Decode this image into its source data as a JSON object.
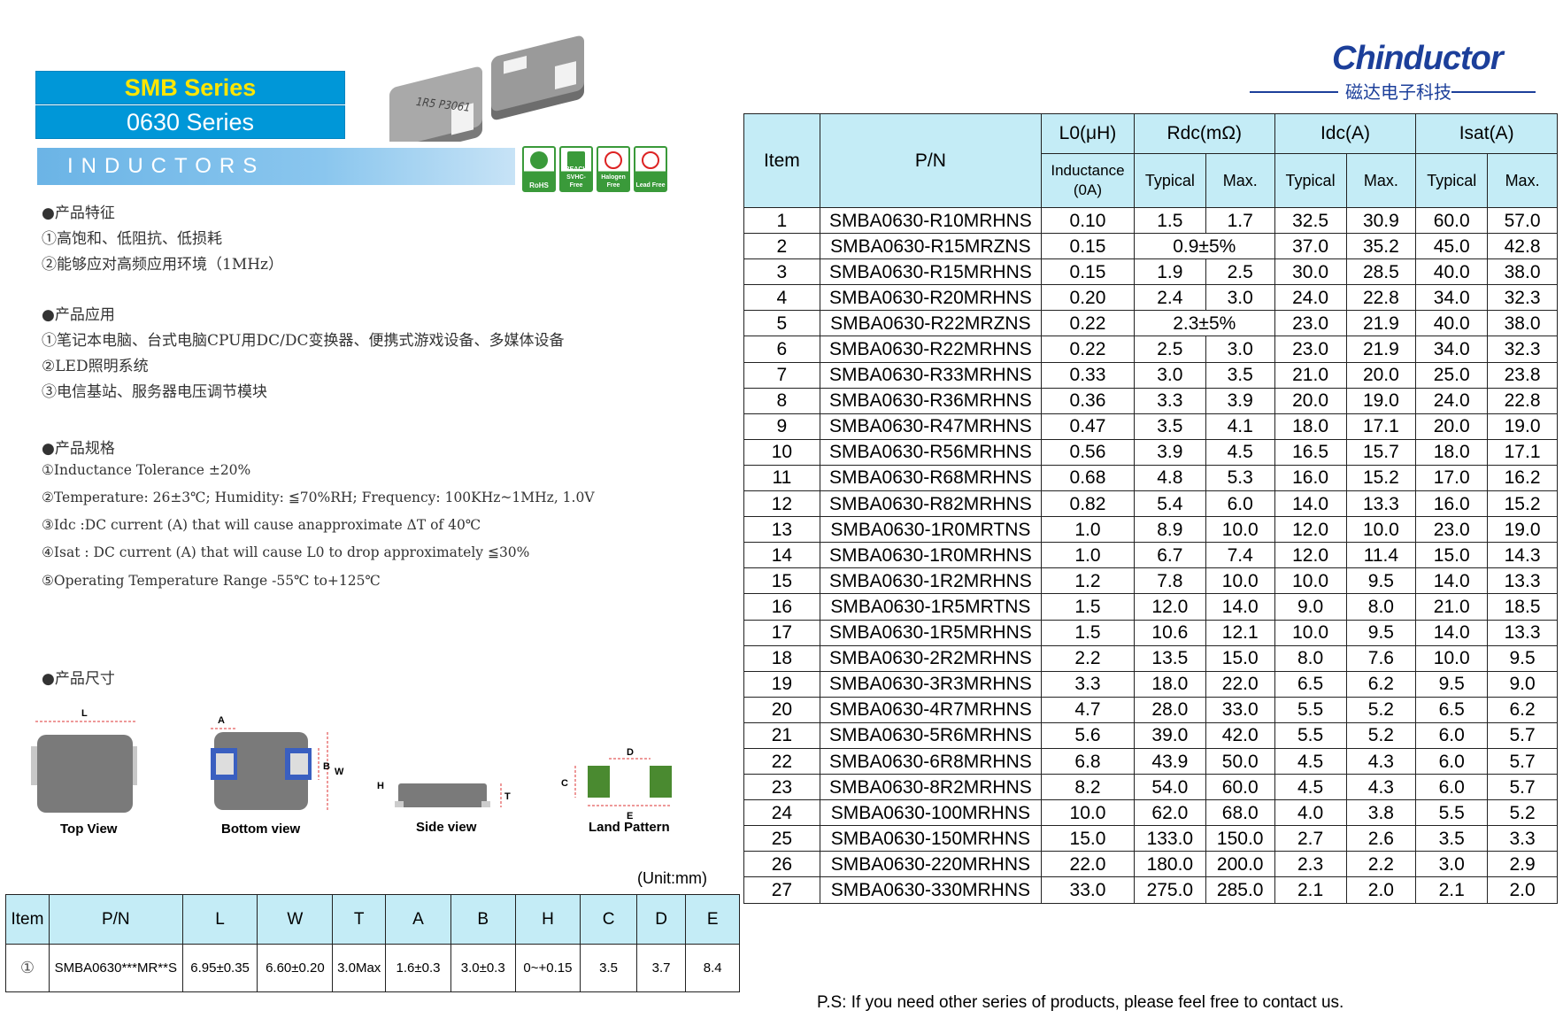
{
  "header": {
    "series_line1": "SMB Series",
    "series_line2": "0630 Series",
    "category": "INDUCTORS",
    "badges": [
      {
        "icon": "rohs-leaf-icon",
        "label": "RoHS"
      },
      {
        "icon": "reach-leaf-icon",
        "label": "REACH SVHC-Free"
      },
      {
        "icon": "halogen-free-icon",
        "label": "Halogen Free"
      },
      {
        "icon": "lead-free-icon",
        "label": "Lead Free"
      }
    ],
    "component_marking": "1R5 P3061"
  },
  "logo": {
    "brand": "Chinductor",
    "cn": "磁达电子科技",
    "color": "#1c3f9a"
  },
  "features": {
    "title": "●产品特征",
    "items": [
      "①高饱和、低阻抗、低损耗",
      "②能够应对高频应用环境（1MHz）"
    ]
  },
  "applications": {
    "title": "●产品应用",
    "items": [
      "①笔记本电脑、台式电脑CPU用DC/DC变换器、便携式游戏设备、多媒体设备",
      "②LED照明系统",
      "③电信基站、服务器电压调节模块"
    ]
  },
  "specs": {
    "title": "●产品规格",
    "items": [
      "①Inductance Tolerance ±20%",
      "②Temperature: 26±3℃; Humidity: ≦70%RH; Frequency: 100KHz~1MHz, 1.0V",
      "③Idc :DC current (A) that will cause anapproximate ΔT of 40℃",
      "④Isat : DC current (A) that will cause L0 to drop approximately ≦30%",
      "⑤Operating Temperature Range -55℃ to+125℃"
    ]
  },
  "dimensions": {
    "title": "●产品尺寸",
    "views": {
      "top": "Top View",
      "bottom": "Bottom view",
      "side": "Side view",
      "land": "Land Pattern"
    },
    "labels": {
      "L": "L",
      "A": "A",
      "B": "B",
      "W": "W",
      "H": "H",
      "T": "T",
      "C": "C",
      "D": "D",
      "E": "E"
    },
    "unit": "(Unit:mm)",
    "headers": [
      "Item",
      "P/N",
      "L",
      "W",
      "T",
      "A",
      "B",
      "H",
      "C",
      "D",
      "E"
    ],
    "row": [
      "①",
      "SMBA0630***MR**S",
      "6.95±0.35",
      "6.60±0.20",
      "3.0Max",
      "1.6±0.3",
      "3.0±0.3",
      "0~+0.15",
      "3.5",
      "3.7",
      "8.4"
    ]
  },
  "main_table": {
    "h_item": "Item",
    "h_pn": "P/N",
    "h_l0": "L0(μH)",
    "h_rdc": "Rdc(mΩ)",
    "h_idc": "Idc(A)",
    "h_isat": "Isat(A)",
    "h_inductance": "Inductance (0A)",
    "h_typical": "Typical",
    "h_max": "Max.",
    "rows": [
      [
        "1",
        "SMBA0630-R10MRHNS",
        "0.10",
        "1.5",
        "1.7",
        "32.5",
        "30.9",
        "60.0",
        "57.0"
      ],
      [
        "2",
        "SMBA0630-R15MRZNS",
        "0.15",
        "0.9±5%",
        "",
        "37.0",
        "35.2",
        "45.0",
        "42.8"
      ],
      [
        "3",
        "SMBA0630-R15MRHNS",
        "0.15",
        "1.9",
        "2.5",
        "30.0",
        "28.5",
        "40.0",
        "38.0"
      ],
      [
        "4",
        "SMBA0630-R20MRHNS",
        "0.20",
        "2.4",
        "3.0",
        "24.0",
        "22.8",
        "34.0",
        "32.3"
      ],
      [
        "5",
        "SMBA0630-R22MRZNS",
        "0.22",
        "2.3±5%",
        "",
        "23.0",
        "21.9",
        "40.0",
        "38.0"
      ],
      [
        "6",
        "SMBA0630-R22MRHNS",
        "0.22",
        "2.5",
        "3.0",
        "23.0",
        "21.9",
        "34.0",
        "32.3"
      ],
      [
        "7",
        "SMBA0630-R33MRHNS",
        "0.33",
        "3.0",
        "3.5",
        "21.0",
        "20.0",
        "25.0",
        "23.8"
      ],
      [
        "8",
        "SMBA0630-R36MRHNS",
        "0.36",
        "3.3",
        "3.9",
        "20.0",
        "19.0",
        "24.0",
        "22.8"
      ],
      [
        "9",
        "SMBA0630-R47MRHNS",
        "0.47",
        "3.5",
        "4.1",
        "18.0",
        "17.1",
        "20.0",
        "19.0"
      ],
      [
        "10",
        "SMBA0630-R56MRHNS",
        "0.56",
        "3.9",
        "4.5",
        "16.5",
        "15.7",
        "18.0",
        "17.1"
      ],
      [
        "11",
        "SMBA0630-R68MRHNS",
        "0.68",
        "4.8",
        "5.3",
        "16.0",
        "15.2",
        "17.0",
        "16.2"
      ],
      [
        "12",
        "SMBA0630-R82MRHNS",
        "0.82",
        "5.4",
        "6.0",
        "14.0",
        "13.3",
        "16.0",
        "15.2"
      ],
      [
        "13",
        "SMBA0630-1R0MRTNS",
        "1.0",
        "8.9",
        "10.0",
        "12.0",
        "10.0",
        "23.0",
        "19.0"
      ],
      [
        "14",
        "SMBA0630-1R0MRHNS",
        "1.0",
        "6.7",
        "7.4",
        "12.0",
        "11.4",
        "15.0",
        "14.3"
      ],
      [
        "15",
        "SMBA0630-1R2MRHNS",
        "1.2",
        "7.8",
        "10.0",
        "10.0",
        "9.5",
        "14.0",
        "13.3"
      ],
      [
        "16",
        "SMBA0630-1R5MRTNS",
        "1.5",
        "12.0",
        "14.0",
        "9.0",
        "8.0",
        "21.0",
        "18.5"
      ],
      [
        "17",
        "SMBA0630-1R5MRHNS",
        "1.5",
        "10.6",
        "12.1",
        "10.0",
        "9.5",
        "14.0",
        "13.3"
      ],
      [
        "18",
        "SMBA0630-2R2MRHNS",
        "2.2",
        "13.5",
        "15.0",
        "8.0",
        "7.6",
        "10.0",
        "9.5"
      ],
      [
        "19",
        "SMBA0630-3R3MRHNS",
        "3.3",
        "18.0",
        "22.0",
        "6.5",
        "6.2",
        "9.5",
        "9.0"
      ],
      [
        "20",
        "SMBA0630-4R7MRHNS",
        "4.7",
        "28.0",
        "33.0",
        "5.5",
        "5.2",
        "6.5",
        "6.2"
      ],
      [
        "21",
        "SMBA0630-5R6MRHNS",
        "5.6",
        "39.0",
        "42.0",
        "5.5",
        "5.2",
        "6.0",
        "5.7"
      ],
      [
        "22",
        "SMBA0630-6R8MRHNS",
        "6.8",
        "43.9",
        "50.0",
        "4.5",
        "4.3",
        "6.0",
        "5.7"
      ],
      [
        "23",
        "SMBA0630-8R2MRHNS",
        "8.2",
        "54.0",
        "60.0",
        "4.5",
        "4.3",
        "6.0",
        "5.7"
      ],
      [
        "24",
        "SMBA0630-100MRHNS",
        "10.0",
        "62.0",
        "68.0",
        "4.0",
        "3.8",
        "5.5",
        "5.2"
      ],
      [
        "25",
        "SMBA0630-150MRHNS",
        "15.0",
        "133.0",
        "150.0",
        "2.7",
        "2.6",
        "3.5",
        "3.3"
      ],
      [
        "26",
        "SMBA0630-220MRHNS",
        "22.0",
        "180.0",
        "200.0",
        "2.3",
        "2.2",
        "3.0",
        "2.9"
      ],
      [
        "27",
        "SMBA0630-330MRHNS",
        "33.0",
        "275.0",
        "285.0",
        "2.1",
        "2.0",
        "2.1",
        "2.0"
      ]
    ]
  },
  "footer": {
    "note": "P.S: If you need other series of products, please feel free to contact us."
  },
  "colors": {
    "header_blue": "#0097d8",
    "series_yellow": "#ffe600",
    "table_header": "#c4ecf6",
    "brand_blue": "#1c3f9a",
    "badge_green": "#3a9a3a"
  }
}
